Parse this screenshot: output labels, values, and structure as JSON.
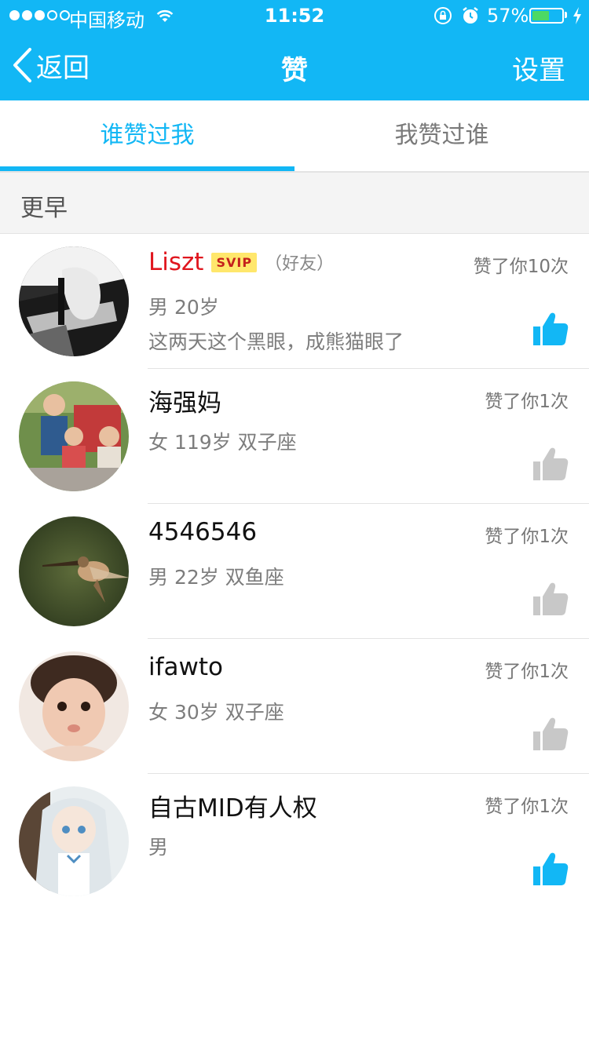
{
  "status_bar": {
    "carrier": "中国移动",
    "time": "11:52",
    "battery_percent": "57%",
    "battery_level": 0.57,
    "battery_color": "#4cd964"
  },
  "nav": {
    "back_label": "返回",
    "title": "赞",
    "settings_label": "设置"
  },
  "tabs": [
    {
      "label": "谁赞过我",
      "active": true
    },
    {
      "label": "我赞过谁",
      "active": false
    }
  ],
  "section": {
    "label": "更早"
  },
  "list": [
    {
      "name": "Liszt",
      "vip": "SVIP",
      "friend": "（好友）",
      "count": "赞了你10次",
      "info": "男 20岁",
      "signature": "这两天这个黑眼，成熊猫眼了",
      "liked": true
    },
    {
      "name": "海强妈",
      "count": "赞了你1次",
      "info": "女 119岁  双子座",
      "liked": false
    },
    {
      "name": "4546546",
      "count": "赞了你1次",
      "info": "男 22岁  双鱼座",
      "liked": false
    },
    {
      "name": "ifawto",
      "count": "赞了你1次",
      "info": "女 30岁  双子座",
      "liked": false
    },
    {
      "name": "自古MID有人权",
      "count": "赞了你1次",
      "info": "男",
      "liked": true
    }
  ],
  "colors": {
    "accent": "#12b7f5",
    "thumb_active": "#12b7f5",
    "thumb_inactive": "#c8c8c8",
    "vip_name": "#e0161e"
  }
}
